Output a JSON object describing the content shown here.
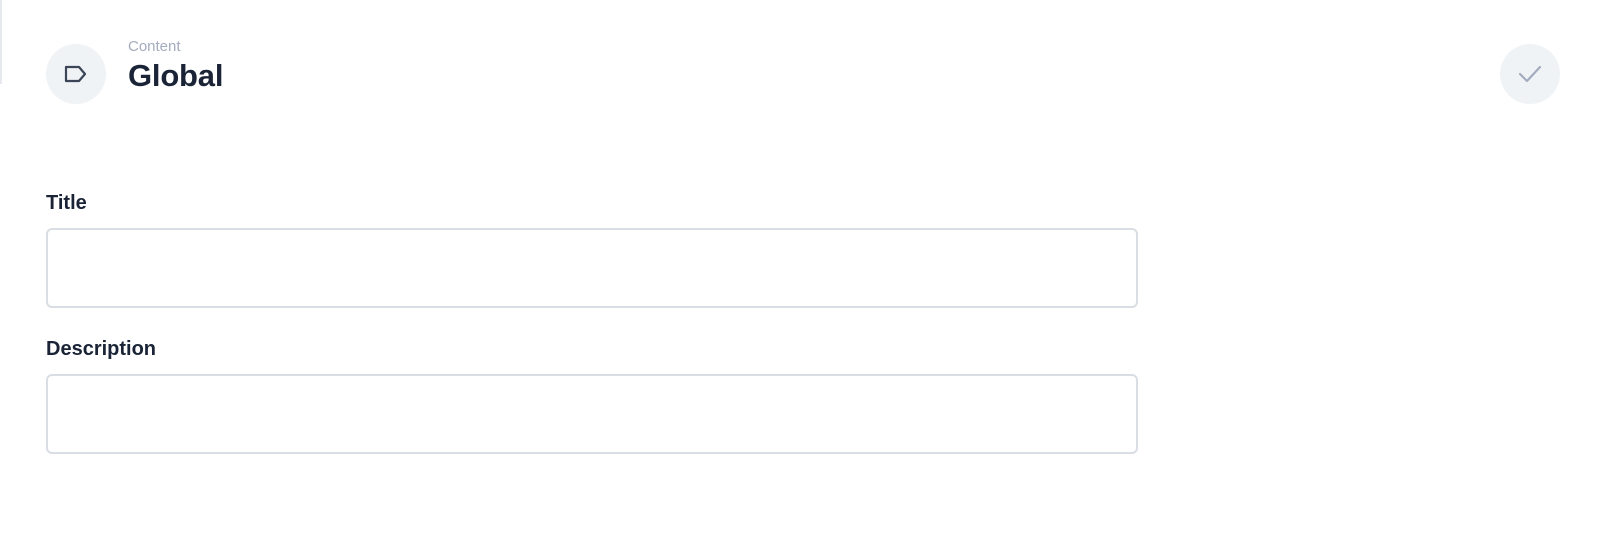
{
  "header": {
    "breadcrumb": "Content",
    "title": "Global",
    "collection_icon": "tag-icon",
    "save_icon": "check-icon"
  },
  "form": {
    "fields": [
      {
        "label": "Title",
        "value": "",
        "placeholder": ""
      },
      {
        "label": "Description",
        "value": "",
        "placeholder": ""
      }
    ]
  },
  "colors": {
    "icon_background": "#f0f3f6",
    "title_text": "#1a2436",
    "breadcrumb_text": "#a3acbf",
    "input_border": "#d9dee5"
  }
}
